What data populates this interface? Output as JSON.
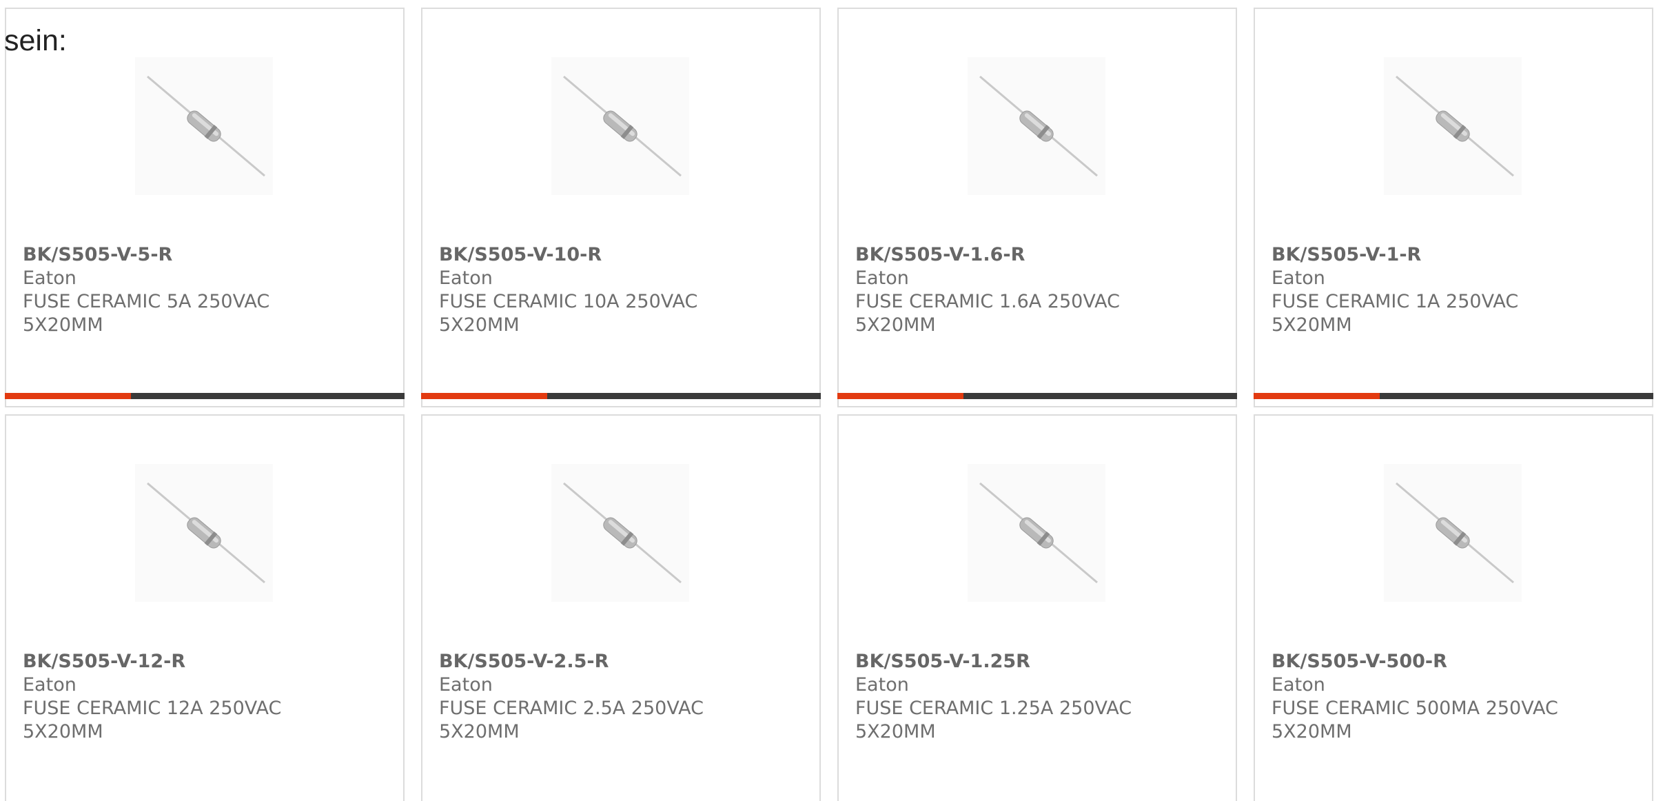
{
  "intro_text": "sein:",
  "colors": {
    "accent": "#e23a10",
    "bar": "#3a3a3a",
    "card_border": "#dcdcdc",
    "text": "#6e6e6e"
  },
  "image_icon": "axial-fuse-icon",
  "products": [
    {
      "sku": "BK/S505-V-5-R",
      "manufacturer": "Eaton",
      "desc1": "FUSE CERAMIC 5A 250VAC",
      "desc2": "5X20MM"
    },
    {
      "sku": "BK/S505-V-10-R",
      "manufacturer": "Eaton",
      "desc1": "FUSE CERAMIC 10A 250VAC",
      "desc2": "5X20MM"
    },
    {
      "sku": "BK/S505-V-1.6-R",
      "manufacturer": "Eaton",
      "desc1": "FUSE CERAMIC 1.6A 250VAC",
      "desc2": "5X20MM"
    },
    {
      "sku": "BK/S505-V-1-R",
      "manufacturer": "Eaton",
      "desc1": "FUSE CERAMIC 1A 250VAC",
      "desc2": "5X20MM"
    },
    {
      "sku": "BK/S505-V-12-R",
      "manufacturer": "Eaton",
      "desc1": "FUSE CERAMIC 12A 250VAC",
      "desc2": "5X20MM"
    },
    {
      "sku": "BK/S505-V-2.5-R",
      "manufacturer": "Eaton",
      "desc1": "FUSE CERAMIC 2.5A 250VAC",
      "desc2": "5X20MM"
    },
    {
      "sku": "BK/S505-V-1.25R",
      "manufacturer": "Eaton",
      "desc1": "FUSE CERAMIC 1.25A 250VAC",
      "desc2": "5X20MM"
    },
    {
      "sku": "BK/S505-V-500-R",
      "manufacturer": "Eaton",
      "desc1": "FUSE CERAMIC 500MA 250VAC",
      "desc2": "5X20MM"
    }
  ]
}
